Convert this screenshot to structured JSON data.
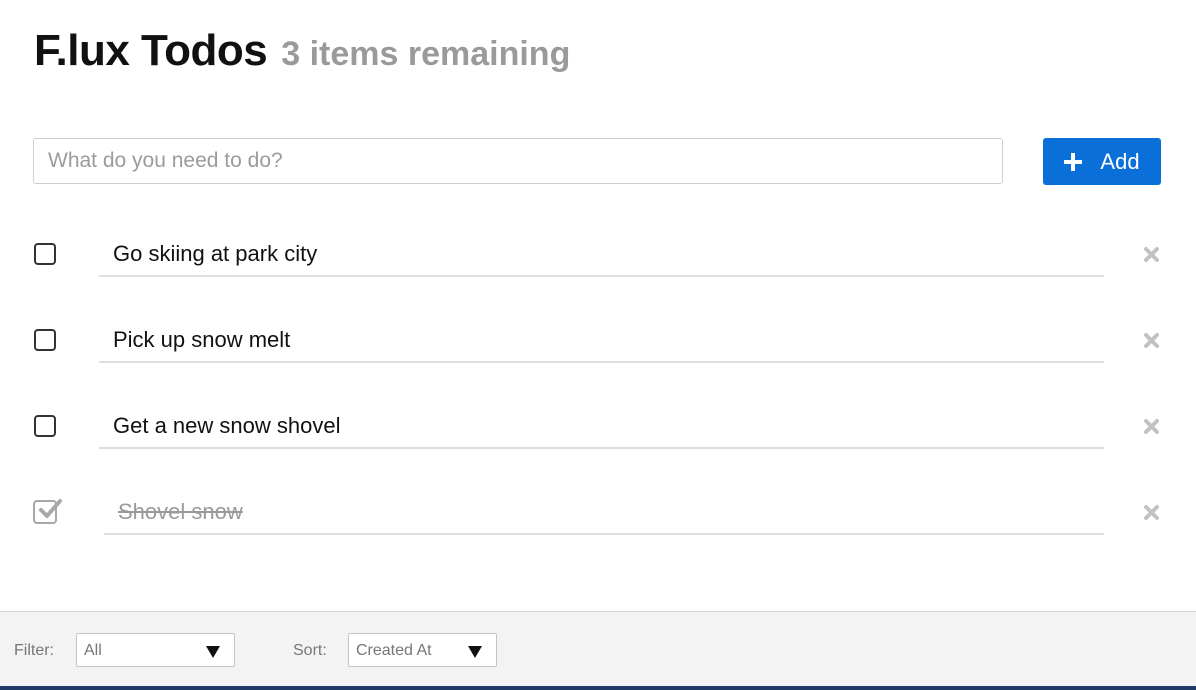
{
  "header": {
    "title": "F.lux Todos",
    "remaining_text": "3 items remaining"
  },
  "new_todo": {
    "placeholder": "What do you need to do?",
    "value": "",
    "add_label": "Add"
  },
  "todos": [
    {
      "text": "Go skiing at park city",
      "completed": false
    },
    {
      "text": "Pick up snow melt",
      "completed": false
    },
    {
      "text": "Get a new snow shovel",
      "completed": false
    },
    {
      "text": "Shovel snow",
      "completed": true
    }
  ],
  "footer": {
    "filter_label": "Filter:",
    "filter_value": "All",
    "sort_label": "Sort:",
    "sort_value": "Created At"
  },
  "colors": {
    "accent": "#0a6fd9",
    "muted_text": "#9a9a9a",
    "footer_bg": "#f3f3f3",
    "bottom_bar": "#1f3a66"
  },
  "icons": {
    "add": "plus-icon",
    "delete": "close-icon",
    "completed": "checkmark-icon",
    "dropdown": "caret-down-icon"
  }
}
